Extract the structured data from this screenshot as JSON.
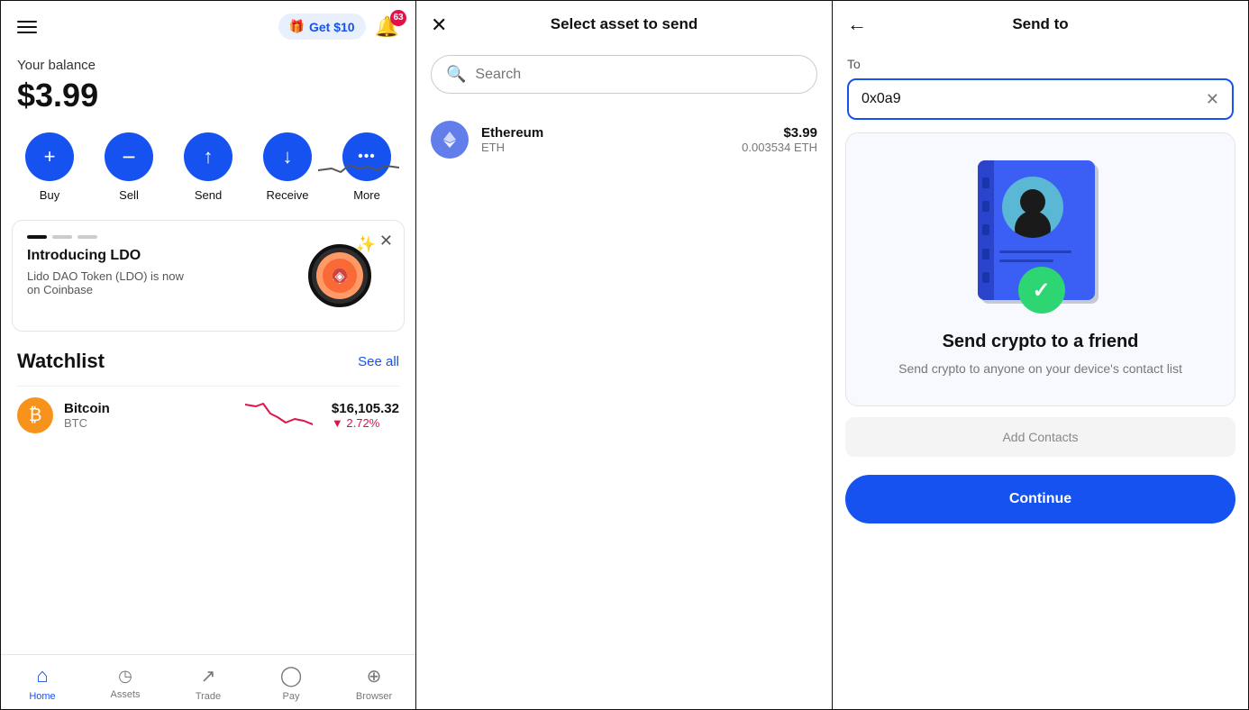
{
  "home": {
    "header": {
      "get_label": "Get $10",
      "notif_badge": "63"
    },
    "balance": {
      "label": "Your balance",
      "amount": "$3.99"
    },
    "actions": [
      {
        "id": "buy",
        "label": "Buy",
        "icon": "+"
      },
      {
        "id": "sell",
        "label": "Sell",
        "icon": "−"
      },
      {
        "id": "send",
        "label": "Send",
        "icon": "↑"
      },
      {
        "id": "receive",
        "label": "Receive",
        "icon": "↓"
      },
      {
        "id": "more",
        "label": "More",
        "icon": "···"
      }
    ],
    "promo": {
      "title": "Introducing LDO",
      "description": "Lido DAO Token (LDO) is now on Coinbase"
    },
    "watchlist": {
      "title": "Watchlist",
      "see_all": "See all",
      "items": [
        {
          "name": "Bitcoin",
          "symbol": "BTC",
          "price": "$16,105.32",
          "change": "▼ 2.72%"
        }
      ]
    },
    "nav": [
      {
        "id": "home",
        "label": "Home",
        "active": true
      },
      {
        "id": "assets",
        "label": "Assets",
        "active": false
      },
      {
        "id": "trade",
        "label": "Trade",
        "active": false
      },
      {
        "id": "pay",
        "label": "Pay",
        "active": false
      },
      {
        "id": "browser",
        "label": "Browser",
        "active": false
      }
    ]
  },
  "asset_panel": {
    "title": "Select asset to send",
    "search_placeholder": "Search",
    "assets": [
      {
        "name": "Ethereum",
        "symbol": "ETH",
        "usd_value": "$3.99",
        "crypto_value": "0.003534 ETH"
      }
    ]
  },
  "send_panel": {
    "title": "Send to",
    "to_label": "To",
    "address_value": "0x0a9",
    "card": {
      "title": "Send crypto to a friend",
      "description": "Send crypto to anyone on your device's contact list"
    },
    "continue_label": "Continue"
  },
  "icons": {
    "hamburger": "☰",
    "gift": "🎁",
    "bell": "🔔",
    "close": "✕",
    "back": "←",
    "search": "🔍",
    "clear": "✕",
    "check": "✓",
    "home": "⌂",
    "assets": "◷",
    "trade": "↗",
    "pay": "◯",
    "browser": "⊕"
  },
  "colors": {
    "blue": "#1652f0",
    "red": "#e0124a",
    "green": "#2ed573",
    "btc_orange": "#f7931a",
    "eth_blue": "#627eea"
  }
}
